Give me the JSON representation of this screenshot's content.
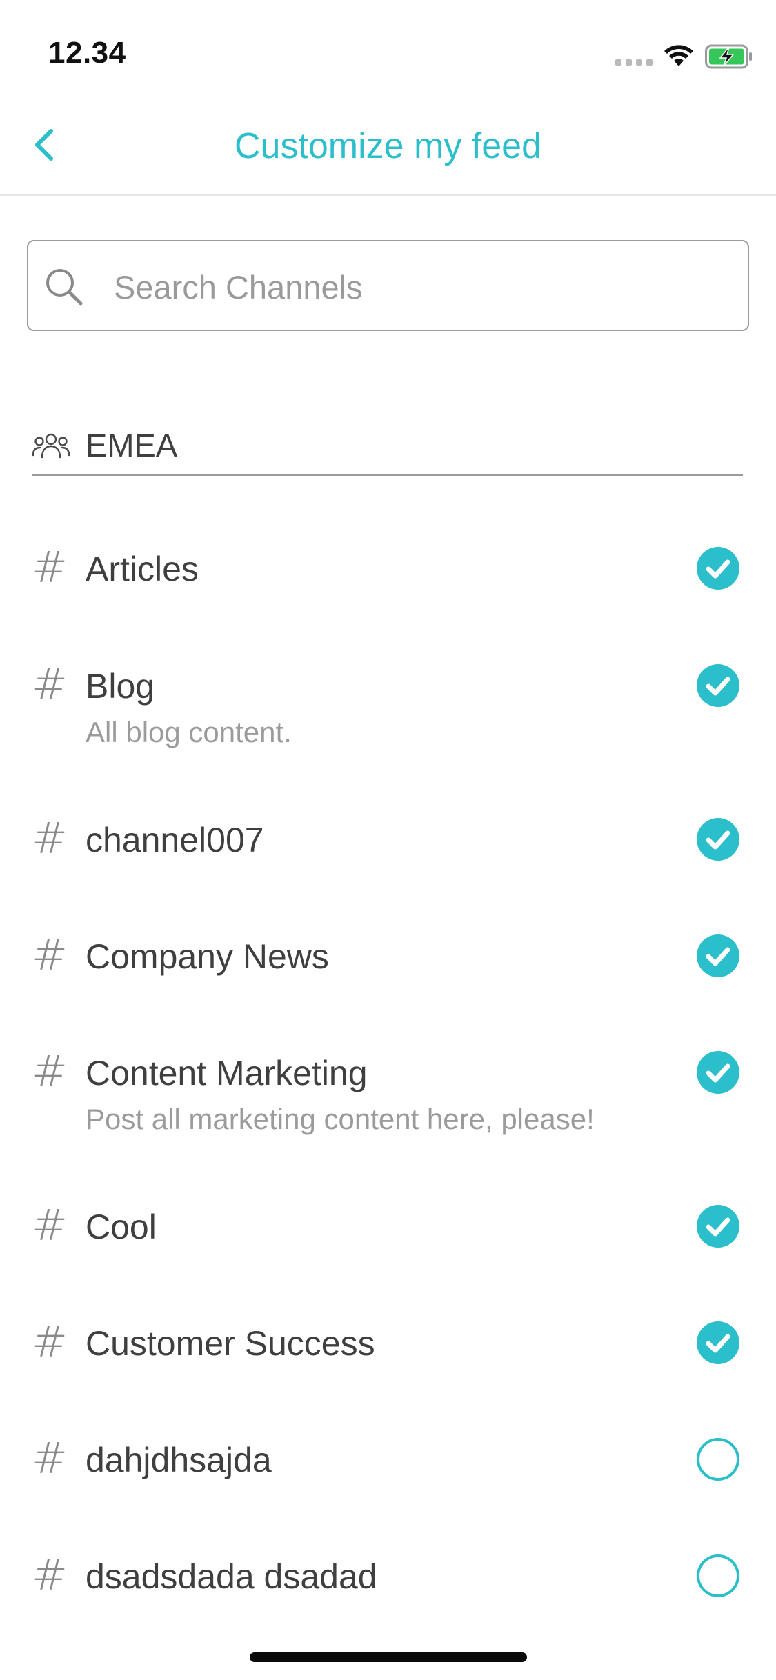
{
  "status_bar": {
    "time": "12.34"
  },
  "nav": {
    "title": "Customize my feed",
    "back_icon": "chevron-left-icon"
  },
  "search": {
    "placeholder": "Search Channels",
    "value": ""
  },
  "group": {
    "label": "EMEA",
    "icon": "users-icon"
  },
  "colors": {
    "accent": "#2bbecb",
    "text": "#3f3f3f",
    "muted": "#9b9b9b"
  },
  "channels": [
    {
      "name": "Articles",
      "description": "",
      "selected": true
    },
    {
      "name": "Blog",
      "description": "All blog content.",
      "selected": true
    },
    {
      "name": "channel007",
      "description": "",
      "selected": true
    },
    {
      "name": "Company News",
      "description": "",
      "selected": true
    },
    {
      "name": "Content Marketing",
      "description": "Post all marketing content here, please!",
      "selected": true
    },
    {
      "name": "Cool",
      "description": "",
      "selected": true
    },
    {
      "name": "Customer Success",
      "description": "",
      "selected": true
    },
    {
      "name": "dahjdhsajda",
      "description": "",
      "selected": false
    },
    {
      "name": "dsadsdada dsadad",
      "description": "",
      "selected": false
    }
  ]
}
